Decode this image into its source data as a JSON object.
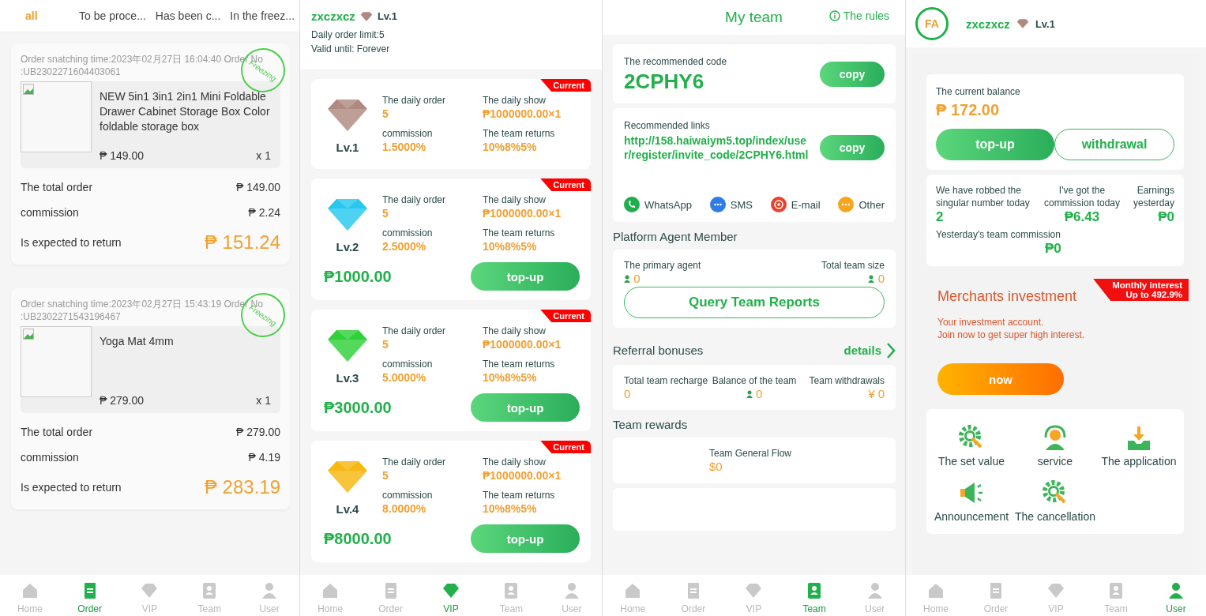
{
  "order_page": {
    "tabs": [
      {
        "label": "all",
        "selected": true
      },
      {
        "label": "To be proce...",
        "selected": false
      },
      {
        "label": "Has been c...",
        "selected": false
      },
      {
        "label": "In the freez...",
        "selected": false
      }
    ],
    "orders": [
      {
        "time_line": "Order snatching time:2023年02月27日 16:04:40 Order No",
        "order_no": ":UB2302271604403061",
        "stamp": "Freezing",
        "product": "NEW 5in1 3in1 2in1 Mini Foldable Drawer Cabinet Storage Box Color foldable storage box",
        "price": "₱ 149.00",
        "quantity": "x 1",
        "rows": [
          {
            "label": "The total order",
            "value": "₱ 149.00",
            "kind": "plain"
          },
          {
            "label": "commission",
            "value": "₱ 2.24",
            "kind": "plain"
          },
          {
            "label": "Is expected to return",
            "value": "₱ 151.24",
            "kind": "highlight"
          }
        ]
      },
      {
        "time_line": "Order snatching time:2023年02月27日 15:43:19 Order No",
        "order_no": ":UB2302271543196467",
        "stamp": "Freezing",
        "product": "Yoga Mat 4mm",
        "price": "₱ 279.00",
        "quantity": "x 1",
        "rows": [
          {
            "label": "The total order",
            "value": "₱ 279.00",
            "kind": "plain"
          },
          {
            "label": "commission",
            "value": "₱ 4.19",
            "kind": "plain"
          },
          {
            "label": "Is expected to return",
            "value": "₱ 283.19",
            "kind": "highlight"
          }
        ]
      }
    ],
    "nav": [
      {
        "label": "Home",
        "selected": false
      },
      {
        "label": "Order",
        "selected": true
      },
      {
        "label": "VIP",
        "selected": false
      },
      {
        "label": "Team",
        "selected": false
      },
      {
        "label": "User",
        "selected": false
      }
    ]
  },
  "vip_page": {
    "name": "zxczxcz",
    "level": "Lv.1",
    "daily_limit": "Daily order limit:5",
    "valid_until": "Valid until: Forever",
    "levels": [
      {
        "level": "Lv.1",
        "color": "#b08a80",
        "badge": "Current",
        "daily_order_label": "The daily order",
        "daily_order": "5",
        "daily_show_label": "The daily show",
        "daily_show": "₱1000000.00×1",
        "commission_label": "commission",
        "commission": "1.5000%",
        "team_returns_label": "The team returns",
        "team_returns": "10%8%5%"
      },
      {
        "level": "Lv.2",
        "color": "#27c8ee",
        "badge": "Current",
        "daily_order_label": "The daily order",
        "daily_order": "5",
        "daily_show_label": "The daily show",
        "daily_show": "₱1000000.00×1",
        "commission_label": "commission",
        "commission": "2.5000%",
        "team_returns_label": "The team returns",
        "team_returns": "10%8%5%",
        "price": "₱1000.00",
        "button": "top-up"
      },
      {
        "level": "Lv.3",
        "color": "#2fd13a",
        "badge": "Current",
        "daily_order_label": "The daily order",
        "daily_order": "5",
        "daily_show_label": "The daily show",
        "daily_show": "₱1000000.00×1",
        "commission_label": "commission",
        "commission": "5.0000%",
        "team_returns_label": "The team returns",
        "team_returns": "10%8%5%",
        "price": "₱3000.00",
        "button": "top-up"
      },
      {
        "level": "Lv.4",
        "color": "#f7b812",
        "badge": "Current",
        "daily_order_label": "The daily order",
        "daily_order": "5",
        "daily_show_label": "The daily show",
        "daily_show": "₱1000000.00×1",
        "commission_label": "commission",
        "commission": "8.0000%",
        "team_returns_label": "The team returns",
        "team_returns": "10%8%5%",
        "price": "₱8000.00",
        "button": "top-up"
      }
    ],
    "nav": [
      {
        "label": "Home",
        "selected": false
      },
      {
        "label": "Order",
        "selected": false
      },
      {
        "label": "VIP",
        "selected": true
      },
      {
        "label": "Team",
        "selected": false
      },
      {
        "label": "User",
        "selected": false
      }
    ]
  },
  "team_page": {
    "title": "My team",
    "rules": "The rules",
    "code_label": "The recommended code",
    "code": "2CPHY6",
    "copy_code_button": "copy",
    "links_label": "Recommended links",
    "link": "http://158.haiwaiym5.top/index/user/register/invite_code/2CPHY6.html",
    "copy_link_button": "copy",
    "share": [
      {
        "label": "WhatsApp",
        "color": "#1fae4b"
      },
      {
        "label": "SMS",
        "color": "#2f7be8"
      },
      {
        "label": "E-mail",
        "color": "#e8432a"
      },
      {
        "label": "Other",
        "color": "#f7a61c"
      }
    ],
    "agent_title": "Platform Agent Member",
    "agent_stats": [
      {
        "label": "The primary agent",
        "value": "0"
      },
      {
        "label": "Total team size",
        "value": "0"
      }
    ],
    "query_button": "Query Team Reports",
    "referral_title": "Referral bonuses",
    "details": "details",
    "team_stats": [
      {
        "label": "Total team recharge",
        "value": "0",
        "kind": "plain"
      },
      {
        "label": "Balance of the team",
        "value": "0",
        "kind": "person"
      },
      {
        "label": "Team withdrawals",
        "value": "¥ 0",
        "kind": "plain"
      }
    ],
    "rewards_title": "Team rewards",
    "flow_label": "Team General Flow",
    "flow_value": "$0",
    "nav": [
      {
        "label": "Home",
        "selected": false
      },
      {
        "label": "Order",
        "selected": false
      },
      {
        "label": "VIP",
        "selected": false
      },
      {
        "label": "Team",
        "selected": true
      },
      {
        "label": "User",
        "selected": false
      }
    ]
  },
  "user_page": {
    "logo": "FA",
    "name": "zxczxcz",
    "level": "Lv.1",
    "balance_label": "The current balance",
    "balance": "₱ 172.00",
    "buttons": [
      {
        "label": "top-up",
        "kind": "filled"
      },
      {
        "label": "withdrawal",
        "kind": "outline"
      }
    ],
    "stats": [
      {
        "label": "We have robbed the singular number today",
        "value": "2"
      },
      {
        "label": "I've got the commission today",
        "value": "₱6.43"
      },
      {
        "label": "Earnings yesterday",
        "value": "₱0"
      },
      {
        "label": "Yesterday's team commission",
        "value": "₱0"
      }
    ],
    "investment": {
      "title": "Merchants investment",
      "ribbon": [
        "Monthly interest",
        "Up to 492.9%"
      ],
      "lines": [
        "Your investment account.",
        "Join now to get super high interest."
      ],
      "button": "now"
    },
    "menu": [
      {
        "label": "The set value"
      },
      {
        "label": "service"
      },
      {
        "label": "The application"
      },
      {
        "label": "Announcement"
      },
      {
        "label": "The cancellation"
      }
    ],
    "nav": [
      {
        "label": "Home",
        "selected": false
      },
      {
        "label": "Order",
        "selected": false
      },
      {
        "label": "VIP",
        "selected": false
      },
      {
        "label": "Team",
        "selected": false
      },
      {
        "label": "User",
        "selected": true
      }
    ]
  }
}
